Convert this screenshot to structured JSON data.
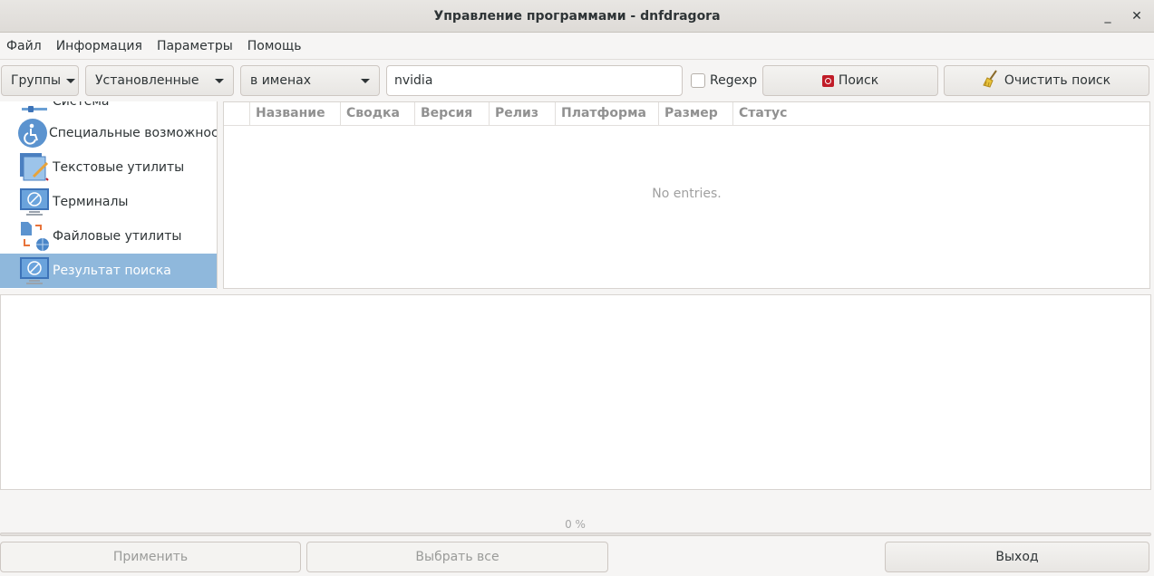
{
  "window": {
    "title": "Управление программами - dnfdragora",
    "minimize": "_",
    "close": "✕"
  },
  "menu": [
    "Файл",
    "Информация",
    "Параметры",
    "Помощь"
  ],
  "toolbar": {
    "groups_label": "Группы",
    "filter_selected": "Установленные",
    "search_in_selected": "в именах",
    "search_value": "nvidia",
    "regexp_label": "Regexp",
    "regexp_checked": false,
    "search_button": "Поиск",
    "clear_button": "Очистить поиск"
  },
  "categories": [
    {
      "label": "Система",
      "icon": "system-icon"
    },
    {
      "label": "Специальные возможности",
      "icon": "accessibility-icon"
    },
    {
      "label": "Текстовые утилиты",
      "icon": "text-editor-icon"
    },
    {
      "label": "Терминалы",
      "icon": "terminal-icon"
    },
    {
      "label": "Файловые утилиты",
      "icon": "file-utilities-icon"
    },
    {
      "label": "Результат поиска",
      "icon": "search-results-icon",
      "selected": true
    }
  ],
  "table": {
    "columns": [
      "Название",
      "Сводка",
      "Версия",
      "Релиз",
      "Платформа",
      "Размер",
      "Статус"
    ],
    "empty_text": "No entries."
  },
  "progress": {
    "label": "0 %",
    "value": 0
  },
  "buttons": {
    "apply": "Применить",
    "select_all": "Выбрать все",
    "exit": "Выход"
  },
  "colors": {
    "selection": "#8fb8dc",
    "accent": "#3584e4"
  }
}
